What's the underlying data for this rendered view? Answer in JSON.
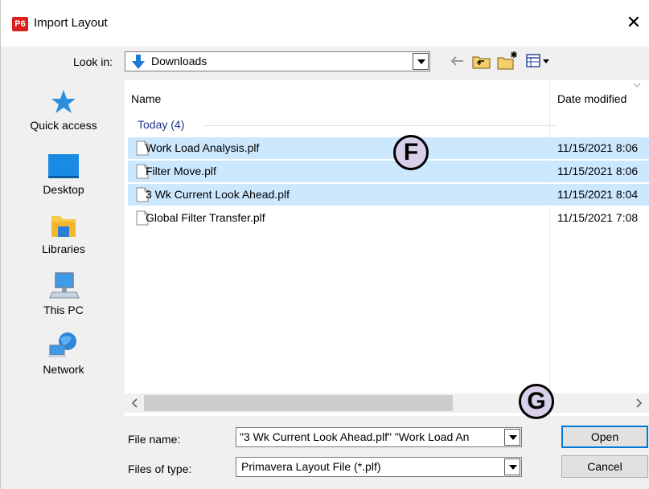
{
  "window": {
    "title": "Import Layout",
    "app_badge": "P6",
    "close_glyph": "✕"
  },
  "lookin": {
    "label": "Look in:",
    "value": "Downloads"
  },
  "places": [
    {
      "label": "Quick access",
      "icon": "star-icon"
    },
    {
      "label": "Desktop",
      "icon": "desktop-icon"
    },
    {
      "label": "Libraries",
      "icon": "libraries-icon"
    },
    {
      "label": "This PC",
      "icon": "computer-icon"
    },
    {
      "label": "Network",
      "icon": "network-icon"
    }
  ],
  "filelist": {
    "columns": {
      "name": "Name",
      "date": "Date modified"
    },
    "group": "Today (4)",
    "files": [
      {
        "name": "Work Load Analysis.plf",
        "date": "11/15/2021 8:06",
        "selected": true
      },
      {
        "name": "Filter Move.plf",
        "date": "11/15/2021 8:06",
        "selected": true
      },
      {
        "name": "3 Wk Current Look Ahead.plf",
        "date": "11/15/2021 8:04",
        "selected": true
      },
      {
        "name": "Global Filter Transfer.plf",
        "date": "11/15/2021 7:08",
        "selected": false
      }
    ]
  },
  "callouts": {
    "f": "F",
    "g": "G"
  },
  "filename": {
    "label": "File name:",
    "value": "\"3 Wk Current Look Ahead.plf\" \"Work Load An"
  },
  "filetype": {
    "label": "Files of type:",
    "value": "Primavera Layout File (*.plf)"
  },
  "buttons": {
    "open": "Open",
    "cancel": "Cancel"
  },
  "colors": {
    "selection": "#cce8ff",
    "group_text": "#1e3287",
    "accent": "#0078d7",
    "badge": "#d9201f"
  }
}
